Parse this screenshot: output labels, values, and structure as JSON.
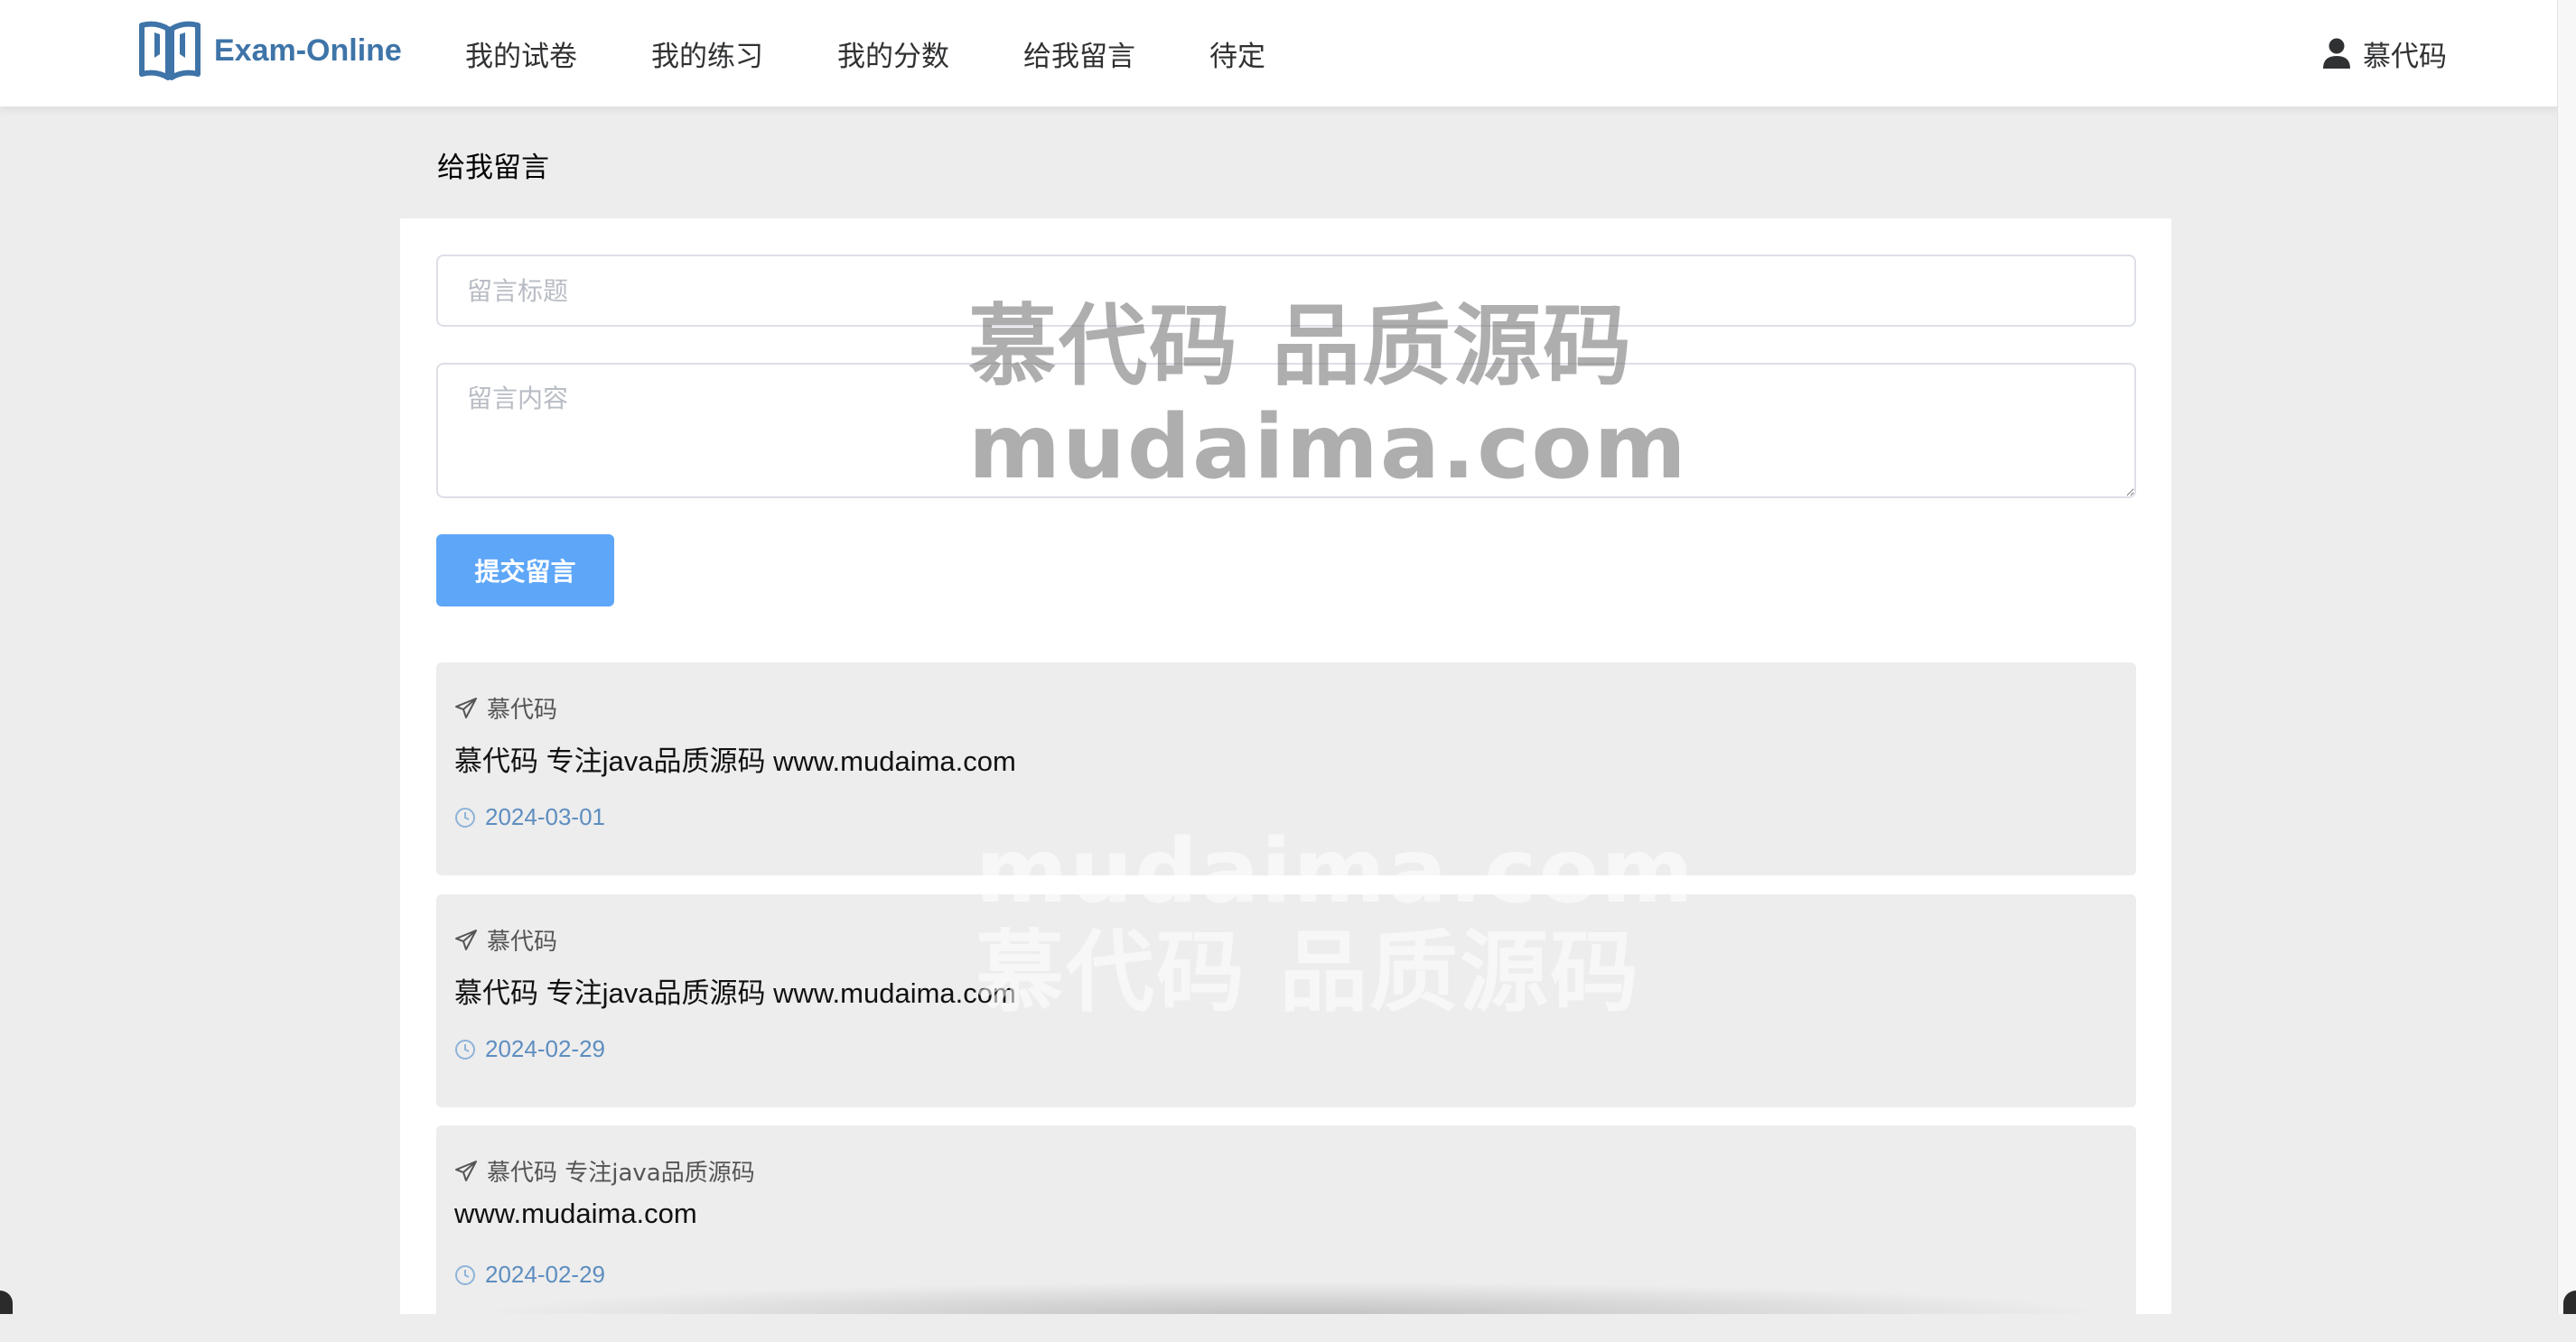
{
  "app": {
    "logo_text": "Exam-Online",
    "brand_color": "#3e74a8"
  },
  "nav": {
    "items": [
      {
        "label": "我的试卷"
      },
      {
        "label": "我的练习"
      },
      {
        "label": "我的分数"
      },
      {
        "label": "给我留言"
      },
      {
        "label": "待定"
      }
    ]
  },
  "user": {
    "name": "慕代码"
  },
  "page": {
    "title": "给我留言"
  },
  "form": {
    "title_placeholder": "留言标题",
    "content_placeholder": "留言内容",
    "submit_label": "提交留言",
    "submit_color": "#5ea6f8"
  },
  "messages": [
    {
      "author": "慕代码",
      "body": "慕代码 专注java品质源码 www.mudaima.com",
      "date": "2024-03-01"
    },
    {
      "author": "慕代码",
      "body": "慕代码 专注java品质源码 www.mudaima.com",
      "date": "2024-02-29"
    },
    {
      "author": "慕代码 专注java品质源码",
      "body": "www.mudaima.com",
      "date": "2024-02-29"
    }
  ],
  "watermark": {
    "top_line1": "慕代码 品质源码",
    "top_line2": "mudaima.com",
    "bottom_line1": "mudaima.com",
    "bottom_line2": "慕代码 品质源码"
  }
}
